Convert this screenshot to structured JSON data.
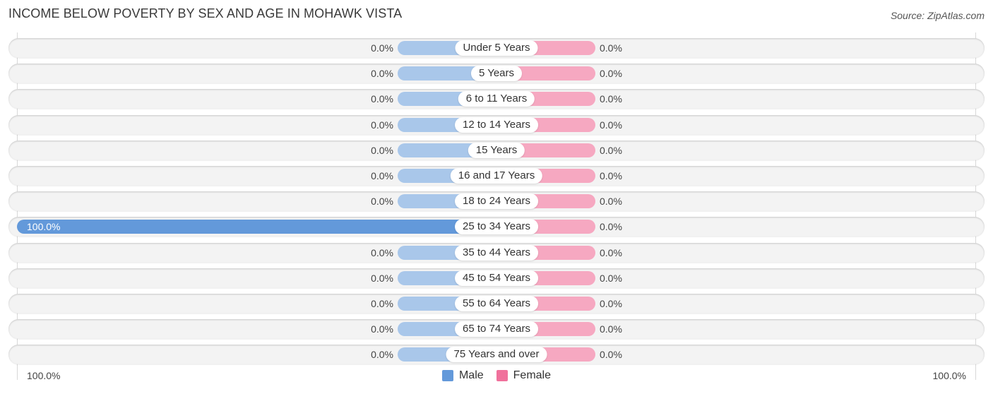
{
  "chart_data": {
    "type": "bar",
    "orientation": "horizontal-diverging",
    "title": "INCOME BELOW POVERTY BY SEX AND AGE IN MOHAWK VISTA",
    "source": "Source: ZipAtlas.com",
    "categories": [
      "Under 5 Years",
      "5 Years",
      "6 to 11 Years",
      "12 to 14 Years",
      "15 Years",
      "16 and 17 Years",
      "18 to 24 Years",
      "25 to 34 Years",
      "35 to 44 Years",
      "45 to 54 Years",
      "55 to 64 Years",
      "65 to 74 Years",
      "75 Years and over"
    ],
    "series": [
      {
        "name": "Male",
        "color": "#6399da",
        "values": [
          0,
          0,
          0,
          0,
          0,
          0,
          0,
          100,
          0,
          0,
          0,
          0,
          0
        ],
        "labels": [
          "0.0%",
          "0.0%",
          "0.0%",
          "0.0%",
          "0.0%",
          "0.0%",
          "0.0%",
          "100.0%",
          "0.0%",
          "0.0%",
          "0.0%",
          "0.0%",
          "0.0%"
        ]
      },
      {
        "name": "Female",
        "color": "#f06292",
        "values": [
          0,
          0,
          0,
          0,
          0,
          0,
          0,
          0,
          0,
          0,
          0,
          0,
          0
        ],
        "labels": [
          "0.0%",
          "0.0%",
          "0.0%",
          "0.0%",
          "0.0%",
          "0.0%",
          "0.0%",
          "0.0%",
          "0.0%",
          "0.0%",
          "0.0%",
          "0.0%",
          "0.0%"
        ]
      }
    ],
    "xlim": [
      -100,
      100
    ],
    "axis_labels": {
      "left": "100.0%",
      "right": "100.0%"
    },
    "legend": {
      "position": "bottom-center",
      "items": [
        {
          "label": "Male",
          "color": "#6399da"
        },
        {
          "label": "Female",
          "color": "#f0719c"
        }
      ]
    },
    "colors": {
      "male_zero_stub": "#a9c7ea",
      "female_zero_stub": "#f6a8c1",
      "row_background": "#f3f3f3"
    }
  }
}
